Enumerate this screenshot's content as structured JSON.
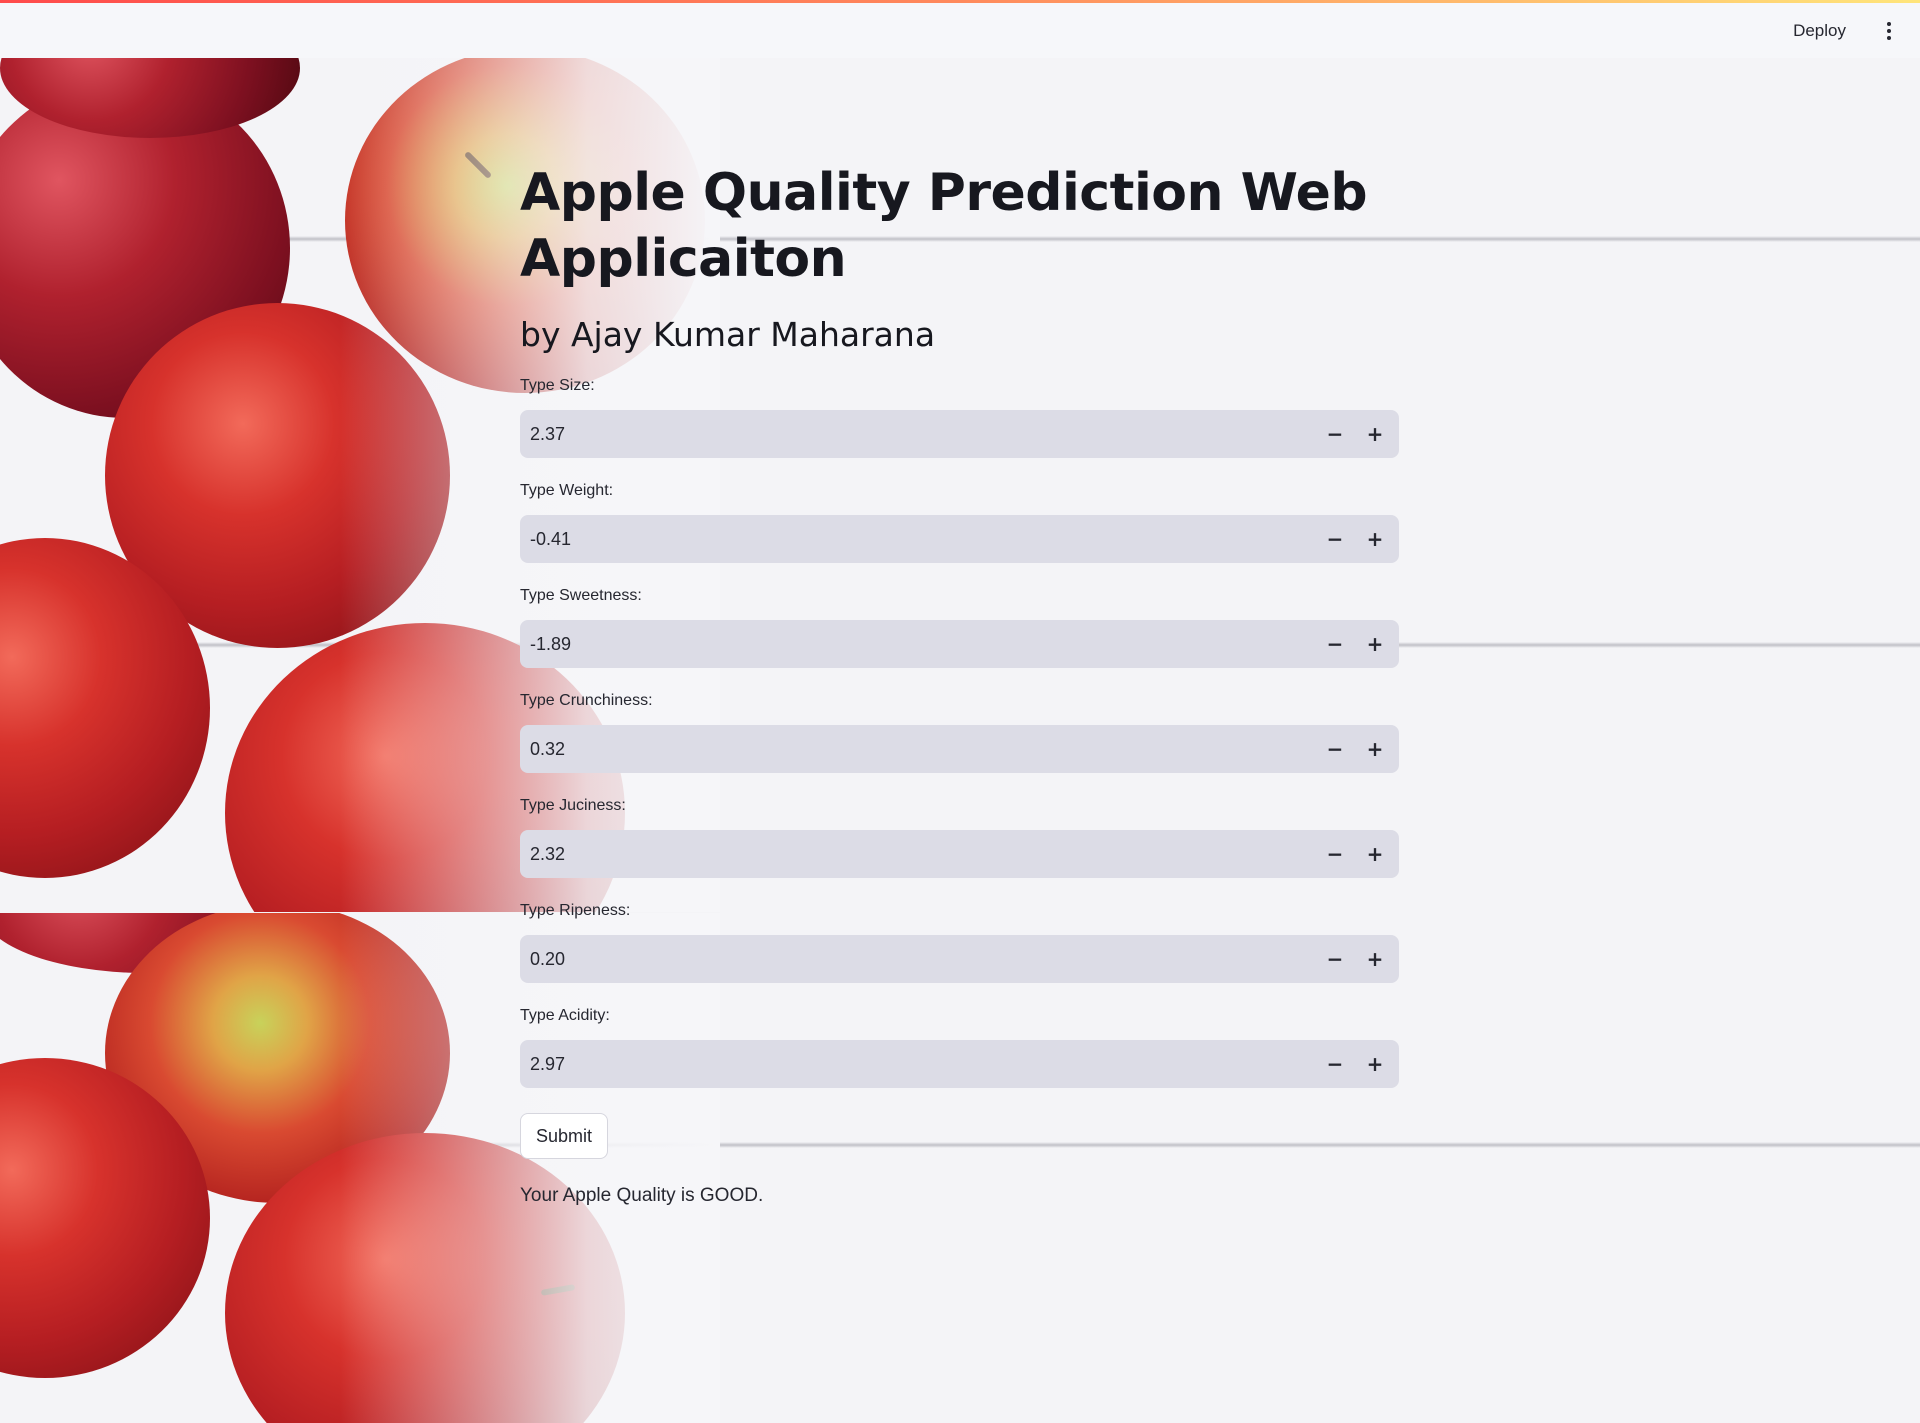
{
  "header": {
    "deploy_label": "Deploy",
    "menu_icon": "more-vertical-icon"
  },
  "page": {
    "title": "Apple Quality Prediction Web Applicaiton",
    "subtitle": "by Ajay Kumar Maharana"
  },
  "form": {
    "fields": [
      {
        "label": "Type Size:",
        "value": "2.37"
      },
      {
        "label": "Type Weight:",
        "value": "-0.41"
      },
      {
        "label": "Type Sweetness:",
        "value": "-1.89"
      },
      {
        "label": "Type Crunchiness:",
        "value": "0.32"
      },
      {
        "label": "Type Juciness:",
        "value": "2.32"
      },
      {
        "label": "Type Ripeness:",
        "value": "0.20"
      },
      {
        "label": "Type Acidity:",
        "value": "2.97"
      }
    ],
    "minus_glyph": "−",
    "plus_glyph": "+",
    "submit_label": "Submit"
  },
  "result": {
    "text": "Your Apple Quality is GOOD."
  },
  "colors": {
    "accent_gradient_start": "#ff4b4b",
    "accent_gradient_end": "#ffe57a",
    "input_background": "#dcdce6",
    "text": "#262730",
    "apple_red": "#b51e22"
  }
}
